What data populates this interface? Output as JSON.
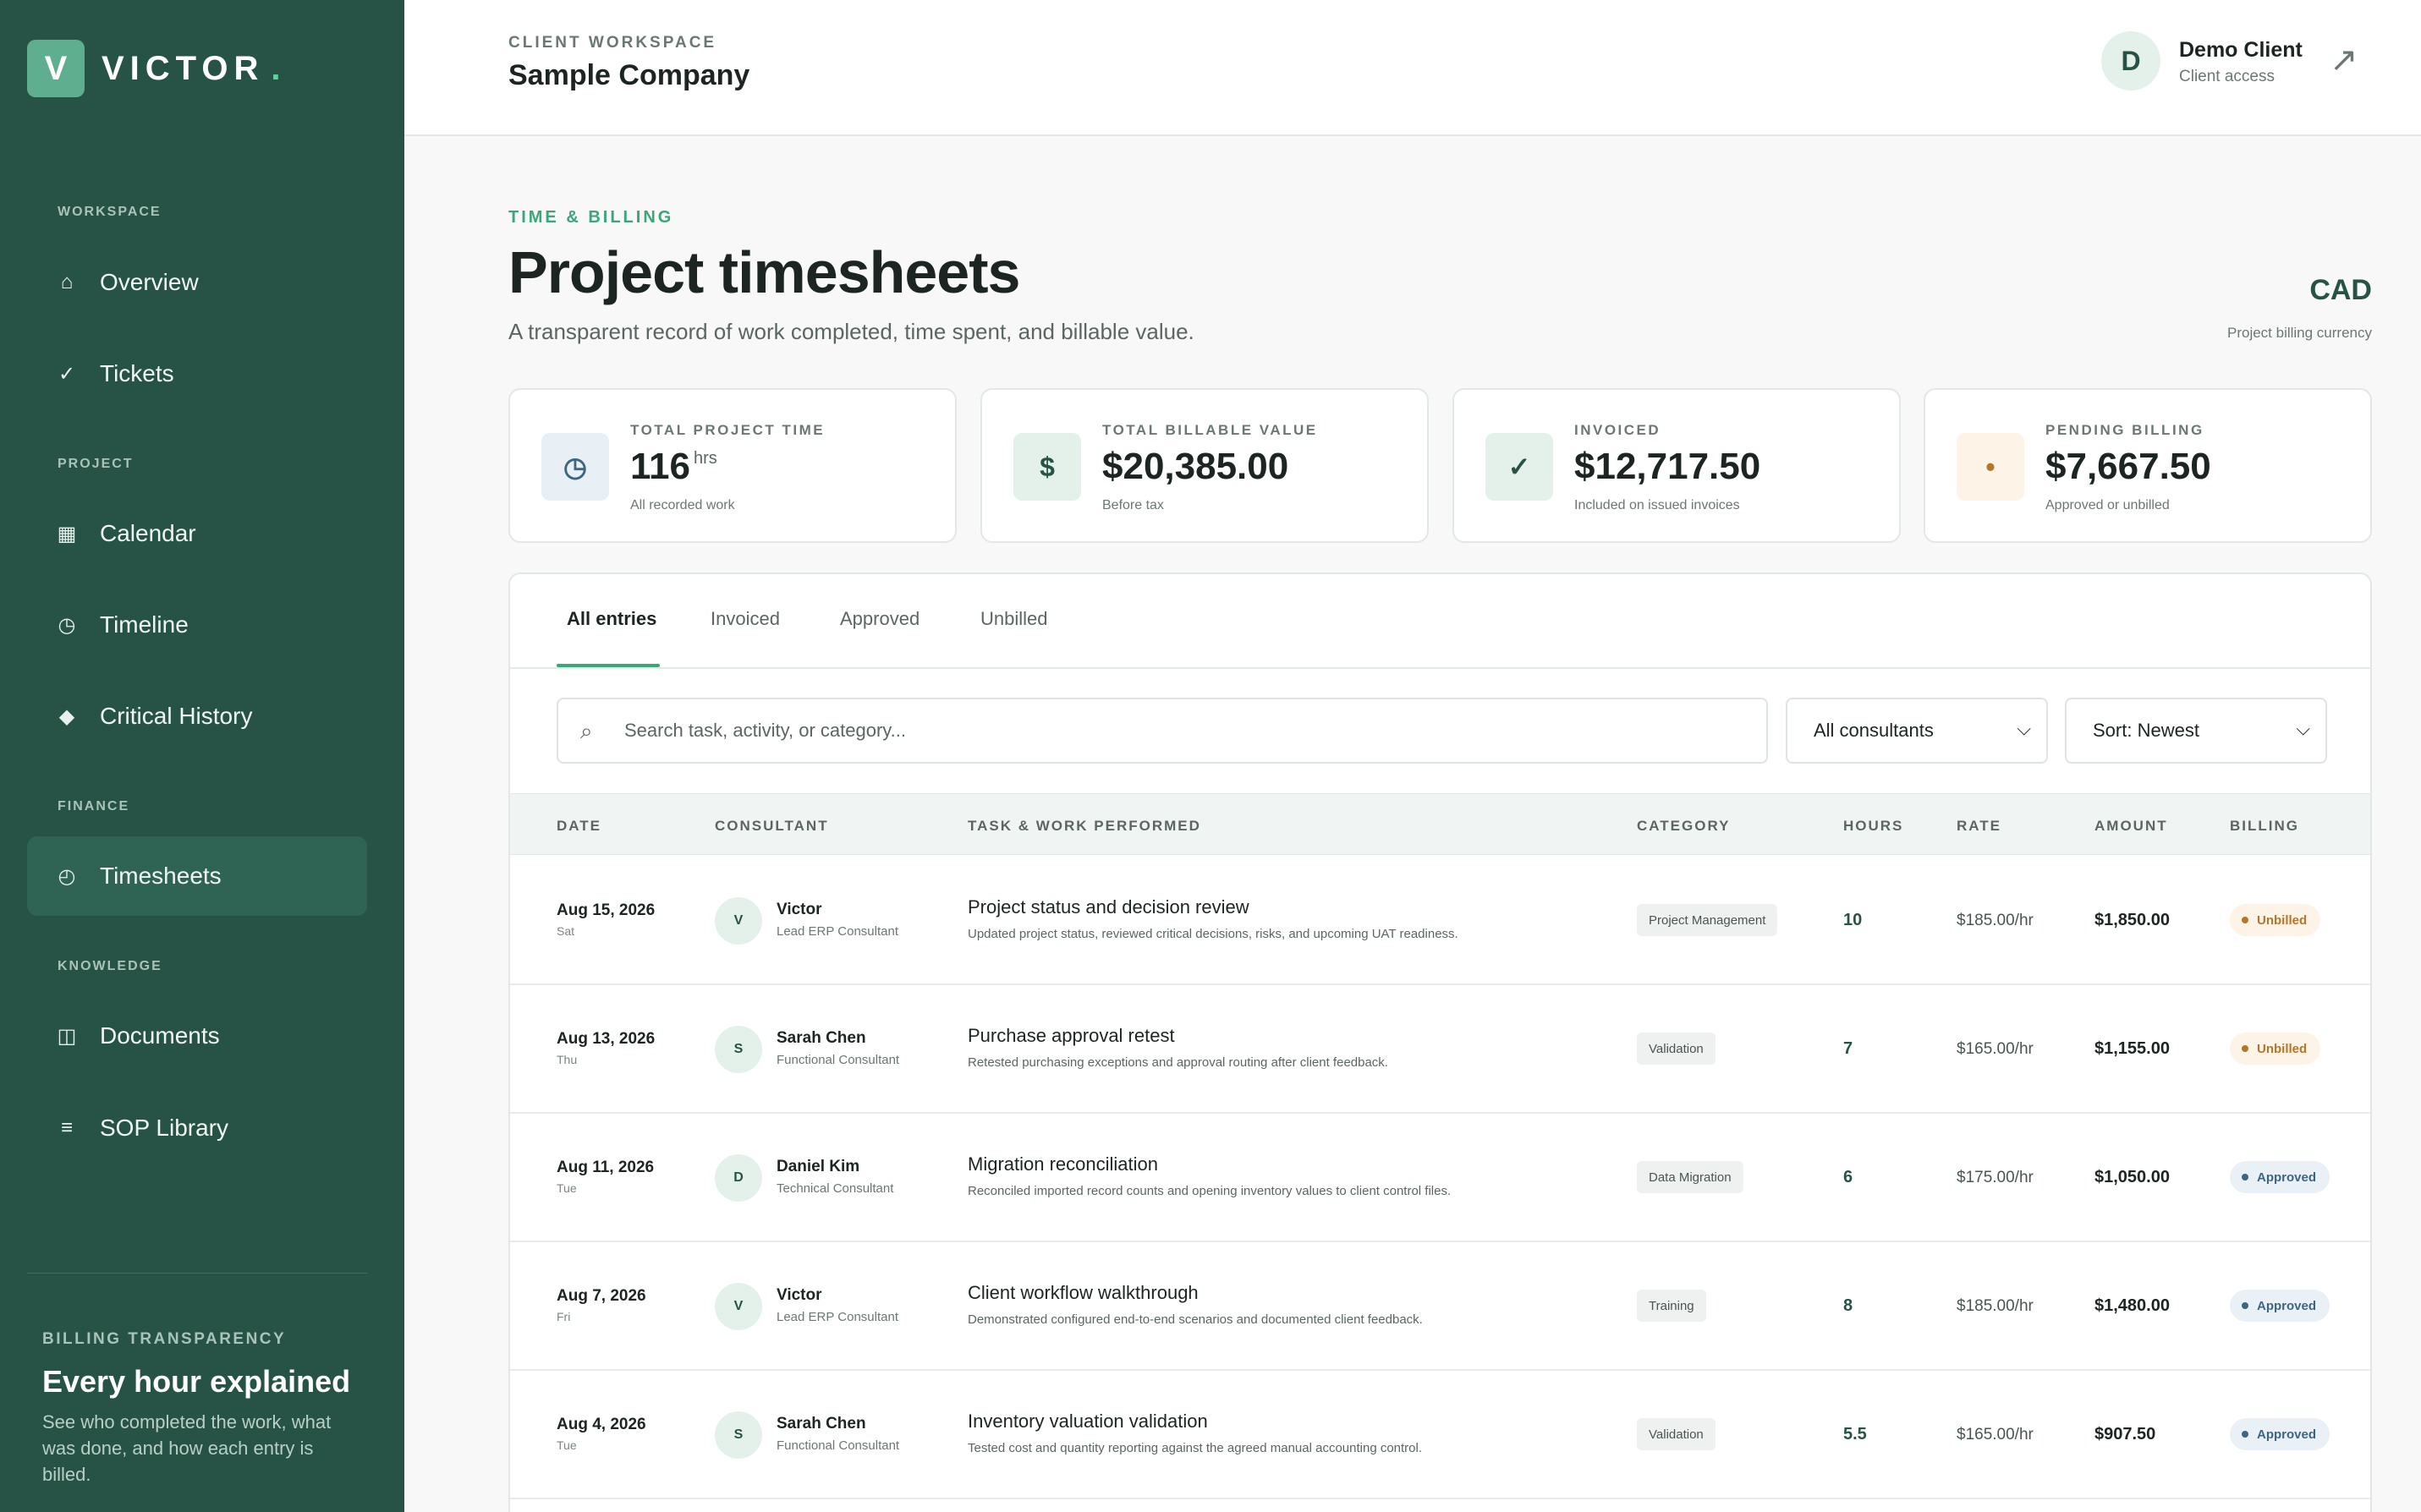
{
  "brand": {
    "mark": "V",
    "name": "VICTOR",
    "dot": "."
  },
  "sidebar": {
    "sections": {
      "workspace": "WORKSPACE",
      "project": "PROJECT",
      "finance": "FINANCE",
      "knowledge": "KNOWLEDGE"
    },
    "items": [
      {
        "label": "Overview",
        "icon": "home-icon",
        "glyph": "⌂"
      },
      {
        "label": "Tickets",
        "icon": "check-icon",
        "glyph": "✓"
      },
      {
        "label": "Calendar",
        "icon": "calendar-icon",
        "glyph": "▦"
      },
      {
        "label": "Timeline",
        "icon": "clock-icon",
        "glyph": "◷"
      },
      {
        "label": "Critical History",
        "icon": "diamond-icon",
        "glyph": "◆"
      },
      {
        "label": "Timesheets",
        "icon": "timesheet-icon",
        "glyph": "◴"
      },
      {
        "label": "Documents",
        "icon": "document-icon",
        "glyph": "◫"
      },
      {
        "label": "SOP Library",
        "icon": "list-icon",
        "glyph": "≡"
      }
    ],
    "promo": {
      "kicker": "BILLING TRANSPARENCY",
      "title": "Every hour explained",
      "text": "See who completed the work, what was done, and how each entry is billed."
    }
  },
  "header": {
    "kicker": "CLIENT WORKSPACE",
    "company": "Sample Company",
    "user": {
      "initial": "D",
      "name": "Demo Client",
      "role": "Client access"
    },
    "external_icon": "↗"
  },
  "page": {
    "kicker": "TIME & BILLING",
    "title": "Project timesheets",
    "subtitle": "A transparent record of work completed, time spent, and billable value.",
    "currency": "CAD",
    "currency_label": "Project billing currency"
  },
  "stats": [
    {
      "kicker": "TOTAL PROJECT TIME",
      "value": "116",
      "unit": "hrs",
      "sub": "All recorded work",
      "icon": "clock-icon",
      "glyph": "◷"
    },
    {
      "kicker": "TOTAL BILLABLE VALUE",
      "value": "$20,385.00",
      "unit": "",
      "sub": "Before tax",
      "icon": "dollar-icon",
      "glyph": "$"
    },
    {
      "kicker": "INVOICED",
      "value": "$12,717.50",
      "unit": "",
      "sub": "Included on issued invoices",
      "icon": "check-icon",
      "glyph": "✓"
    },
    {
      "kicker": "PENDING BILLING",
      "value": "$7,667.50",
      "unit": "",
      "sub": "Approved or unbilled",
      "icon": "pending-dot-icon",
      "glyph": "•"
    }
  ],
  "tabs": [
    "All entries",
    "Invoiced",
    "Approved",
    "Unbilled"
  ],
  "filters": {
    "search_placeholder": "Search task, activity, or category...",
    "consultant": "All consultants",
    "sort": "Sort: Newest"
  },
  "columns": [
    "DATE",
    "CONSULTANT",
    "TASK & WORK PERFORMED",
    "CATEGORY",
    "HOURS",
    "RATE",
    "AMOUNT",
    "BILLING"
  ],
  "entries": [
    {
      "date": "Aug 15, 2026",
      "day": "Sat",
      "initial": "V",
      "consultant": "Victor",
      "role": "Lead ERP Consultant",
      "task": "Project status and decision review",
      "desc": "Updated project status, reviewed critical decisions, risks, and upcoming UAT readiness.",
      "category": "Project Management",
      "hours": "10",
      "rate": "$185.00/hr",
      "amount": "$1,850.00",
      "billing": "Unbilled"
    },
    {
      "date": "Aug 13, 2026",
      "day": "Thu",
      "initial": "S",
      "consultant": "Sarah Chen",
      "role": "Functional Consultant",
      "task": "Purchase approval retest",
      "desc": "Retested purchasing exceptions and approval routing after client feedback.",
      "category": "Validation",
      "hours": "7",
      "rate": "$165.00/hr",
      "amount": "$1,155.00",
      "billing": "Unbilled"
    },
    {
      "date": "Aug 11, 2026",
      "day": "Tue",
      "initial": "D",
      "consultant": "Daniel Kim",
      "role": "Technical Consultant",
      "task": "Migration reconciliation",
      "desc": "Reconciled imported record counts and opening inventory values to client control files.",
      "category": "Data Migration",
      "hours": "6",
      "rate": "$175.00/hr",
      "amount": "$1,050.00",
      "billing": "Approved"
    },
    {
      "date": "Aug 7, 2026",
      "day": "Fri",
      "initial": "V",
      "consultant": "Victor",
      "role": "Lead ERP Consultant",
      "task": "Client workflow walkthrough",
      "desc": "Demonstrated configured end-to-end scenarios and documented client feedback.",
      "category": "Training",
      "hours": "8",
      "rate": "$185.00/hr",
      "amount": "$1,480.00",
      "billing": "Approved"
    },
    {
      "date": "Aug 4, 2026",
      "day": "Tue",
      "initial": "S",
      "consultant": "Sarah Chen",
      "role": "Functional Consultant",
      "task": "Inventory valuation validation",
      "desc": "Tested cost and quantity reporting against the agreed manual accounting control.",
      "category": "Validation",
      "hours": "5.5",
      "rate": "$165.00/hr",
      "amount": "$907.50",
      "billing": "Approved"
    }
  ],
  "colors": {
    "sidebar_bg": "#265346",
    "accent": "#3aa67a",
    "unbilled_bg": "#fdf3e7",
    "unbilled_fg": "#b4762c",
    "approved_bg": "#eaf1f6",
    "approved_fg": "#3d6680"
  }
}
